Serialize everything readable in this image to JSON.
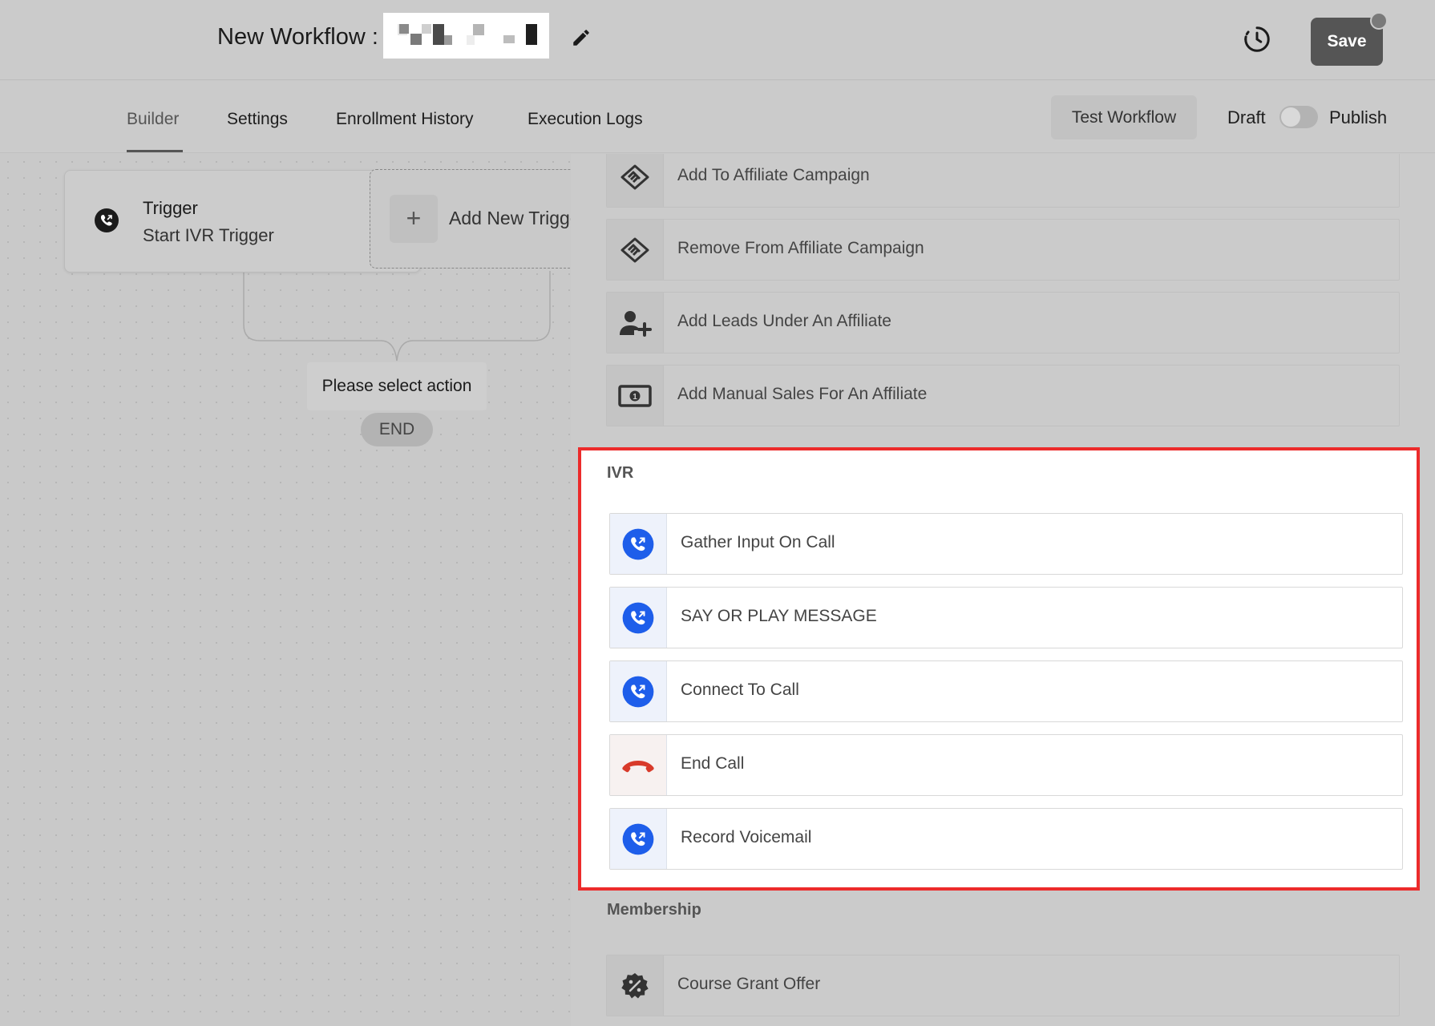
{
  "header": {
    "title": "New Workflow :",
    "save_label": "Save"
  },
  "tabs": [
    {
      "label": "Builder",
      "active": true
    },
    {
      "label": "Settings",
      "active": false
    },
    {
      "label": "Enrollment History",
      "active": false
    },
    {
      "label": "Execution Logs",
      "active": false
    }
  ],
  "toolbar": {
    "test_label": "Test Workflow",
    "draft_label": "Draft",
    "publish_label": "Publish",
    "published": false
  },
  "canvas": {
    "trigger_title": "Trigger",
    "trigger_name": "Start IVR Trigger",
    "add_trigger_label": "Add New Trigger",
    "select_action": "Please select action",
    "end_label": "END"
  },
  "panel": {
    "affiliate_actions": [
      {
        "label": "Add To Affiliate Campaign",
        "icon": "handshake-icon"
      },
      {
        "label": "Remove From Affiliate Campaign",
        "icon": "handshake-icon"
      },
      {
        "label": "Add Leads Under An Affiliate",
        "icon": "user-plus-icon"
      },
      {
        "label": "Add Manual Sales For An Affiliate",
        "icon": "money-bill-icon"
      }
    ],
    "ivr": {
      "title": "IVR",
      "actions": [
        {
          "label": "Gather Input On Call",
          "icon": "phone-outgoing-icon"
        },
        {
          "label": "SAY OR PLAY MESSAGE",
          "icon": "phone-outgoing-icon"
        },
        {
          "label": "Connect To Call",
          "icon": "phone-outgoing-icon"
        },
        {
          "label": "End Call",
          "icon": "hang-up-icon"
        },
        {
          "label": "Record Voicemail",
          "icon": "phone-outgoing-icon"
        }
      ]
    },
    "membership": {
      "title": "Membership",
      "actions": [
        {
          "label": "Course Grant Offer",
          "icon": "discount-badge-icon"
        }
      ]
    }
  },
  "colors": {
    "highlight_border": "#ec2b2b",
    "ivr_icon_blue": "#1e5eea",
    "end_call_red": "#d83a2a"
  }
}
